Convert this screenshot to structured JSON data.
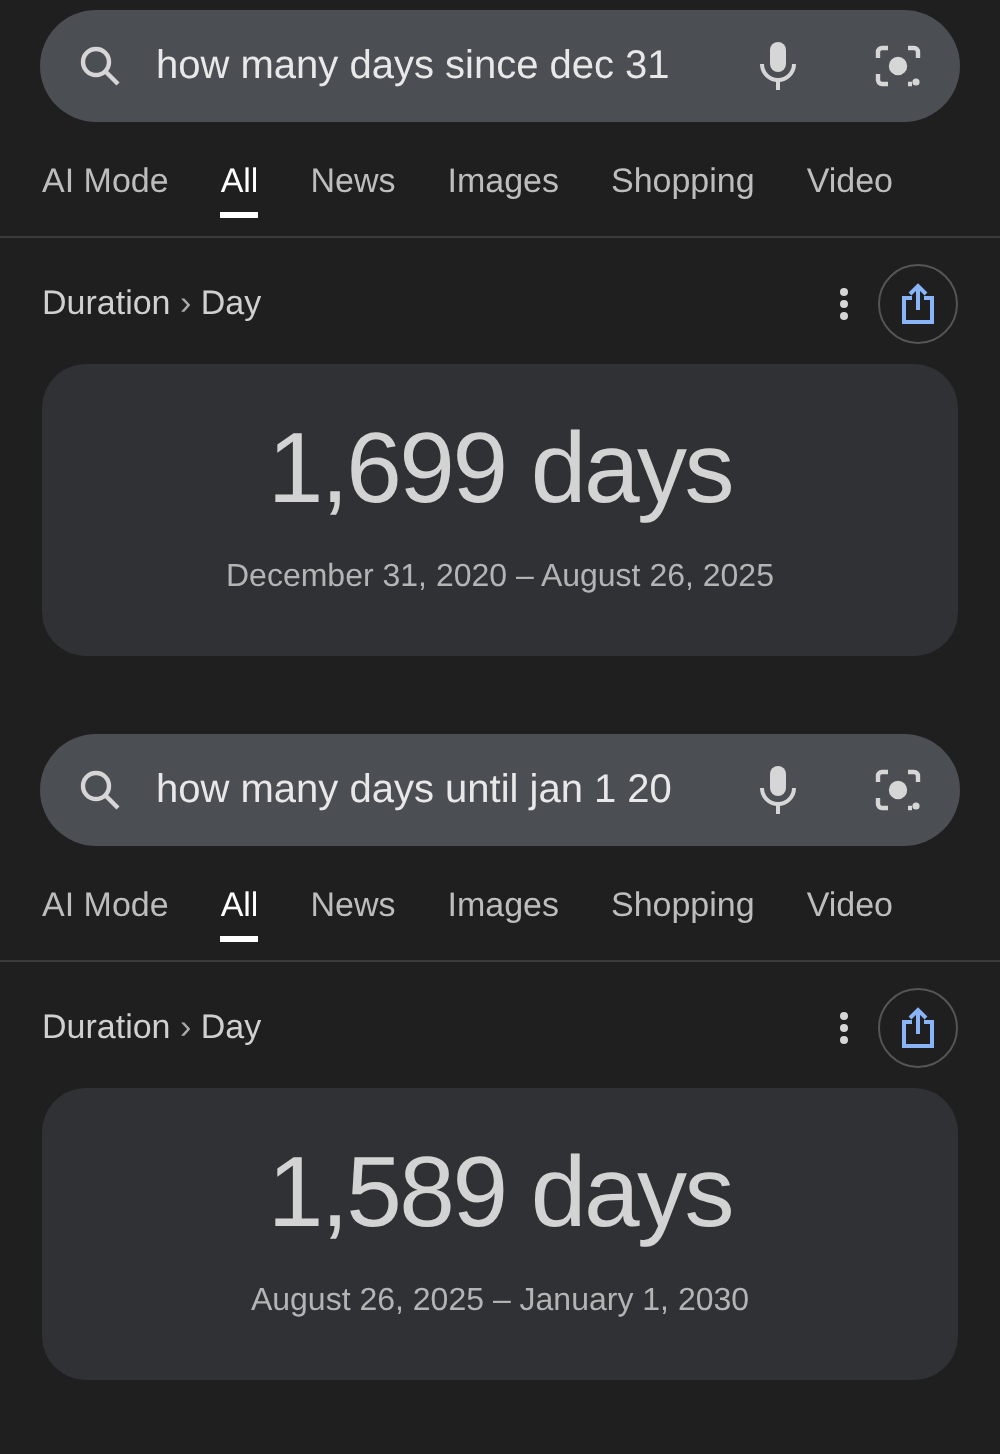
{
  "panels": [
    {
      "search": {
        "value": "how many days since dec 31"
      },
      "tabs": [
        {
          "label": "AI Mode",
          "selected": false
        },
        {
          "label": "All",
          "selected": true
        },
        {
          "label": "News",
          "selected": false
        },
        {
          "label": "Images",
          "selected": false
        },
        {
          "label": "Shopping",
          "selected": false
        },
        {
          "label": "Video",
          "selected": false
        }
      ],
      "breadcrumb": {
        "parent": "Duration",
        "separator": "›",
        "current": "Day"
      },
      "result": {
        "value": "1,699 days",
        "range": "December 31, 2020 – August 26, 2025"
      }
    },
    {
      "search": {
        "value": "how many days until jan 1 20"
      },
      "tabs": [
        {
          "label": "AI Mode",
          "selected": false
        },
        {
          "label": "All",
          "selected": true
        },
        {
          "label": "News",
          "selected": false
        },
        {
          "label": "Images",
          "selected": false
        },
        {
          "label": "Shopping",
          "selected": false
        },
        {
          "label": "Video",
          "selected": false
        }
      ],
      "breadcrumb": {
        "parent": "Duration",
        "separator": "›",
        "current": "Day"
      },
      "result": {
        "value": "1,589 days",
        "range": "August 26, 2025 – January 1, 2030"
      }
    }
  ]
}
